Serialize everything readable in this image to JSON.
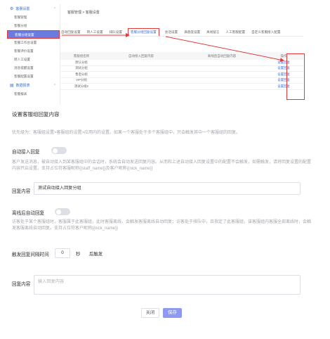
{
  "sidebar": {
    "group1": "客服设置",
    "items": [
      "客服管理",
      "客服分组",
      "客服分组设置",
      "客服工作台设置",
      "客服评价设置",
      "转人工设置",
      "消息提醒设置",
      "客服配置设置"
    ],
    "group2": "数据报表",
    "items2": [
      "客服报表"
    ]
  },
  "breadcrumb": "客服管理 > 客服设置",
  "tabs": [
    "自动回复设置",
    "转人工设置",
    "排队设置",
    "客服分组回复设置",
    "会话设置",
    "满意度设置",
    "离线留言",
    "人工客服配置",
    "自定义客服接入配置"
  ],
  "table": {
    "headers": [
      "客服组名称",
      "自动接入回复内容",
      "离线后自动回复内容",
      "操作"
    ],
    "rows": [
      [
        "默认分组",
        "",
        "",
        "设置回复"
      ],
      [
        "测试分组",
        "",
        "",
        "设置回复"
      ],
      [
        "售后分组",
        "",
        "",
        "设置回复"
      ],
      [
        "VIP分组",
        "",
        "",
        "设置回复"
      ],
      [
        "测试分组2",
        "",
        "",
        "设置回复"
      ]
    ]
  },
  "form": {
    "title": "设置客服组回复内容",
    "priority_desc": "优先级为：客服组设置>客服组的设置>应用内的设置。如果一个客服处于多个客服组中，只会触发其中一个客服组的回复。",
    "auto_reply_label": "自动接入回复",
    "auto_reply_desc": "客户发送消息，被自动接入到某客服组中的会话时，系统会自动发送回复内容。从而和上述自动接入回复设置中的配置不会触发，如需触发，请将回复设置的配置内容开启设置。支持占位符客服昵称{{staff_name}}及客户昵称{{nick_name}}",
    "reply_content_label": "回复内容",
    "reply_content_value": "测试自动接入回复分组",
    "offline_label": "离线后自动回复",
    "offline_desc": "访客处于某个客服组时，客服属于此客服组，此时客服离线，会触发客服离线自动回复；访客处于排队中，且指定了此客服组，该客服组内客服全部离线时，会触发客服离线自动回复。支持占位符客户昵称{{nick_name}}",
    "trigger_label": "触发回复间隔时间",
    "trigger_value": "0",
    "trigger_unit": "秒",
    "trigger_suffix": "后触发",
    "offline_reply_label": "回复内容",
    "offline_reply_placeholder": "输入回复内容"
  },
  "buttons": {
    "close": "关闭",
    "save": "保存"
  },
  "colors": {
    "accent": "#3a6fd8",
    "highlight": "#e23a3a",
    "save_button": "#8d9af0"
  }
}
